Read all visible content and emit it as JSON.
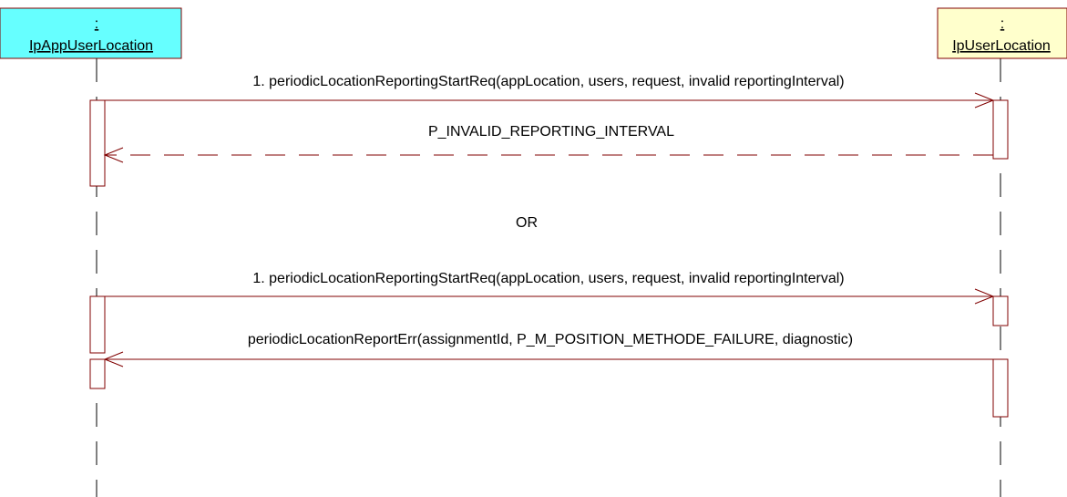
{
  "participants": [
    {
      "id": "app",
      "colon": ":",
      "name": "IpAppUserLocation",
      "fill": "#66ffff"
    },
    {
      "id": "ul",
      "colon": ":",
      "name": "IpUserLocation",
      "fill": "#ffffcc"
    }
  ],
  "messages": {
    "m1": "1. periodicLocationReportingStartReq(appLocation, users, request, invalid reportingInterval)",
    "m2": "P_INVALID_REPORTING_INTERVAL",
    "or": "OR",
    "m3": "1. periodicLocationReportingStartReq(appLocation, users, request, invalid reportingInterval)",
    "m4": "periodicLocationReportErr(assignmentId, P_M_POSITION_METHODE_FAILURE, diagnostic)"
  },
  "colors": {
    "line": "#800000",
    "lifeline": "#000000"
  }
}
